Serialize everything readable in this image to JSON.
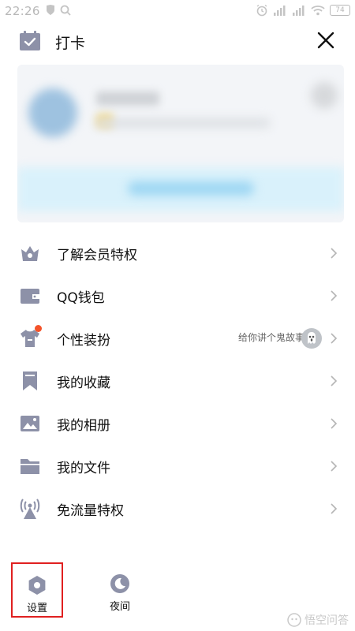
{
  "status_bar": {
    "time": "22:26",
    "battery": "74"
  },
  "header": {
    "checkin_label": "打卡"
  },
  "menu": {
    "items": [
      {
        "label": "了解会员特权",
        "icon": "crown-icon"
      },
      {
        "label": "QQ钱包",
        "icon": "wallet-icon"
      },
      {
        "label": "个性装扮",
        "icon": "tshirt-icon",
        "extra": "给你讲个鬼故事",
        "has_badge": true
      },
      {
        "label": "我的收藏",
        "icon": "bookmark-icon"
      },
      {
        "label": "我的相册",
        "icon": "photo-icon"
      },
      {
        "label": "我的文件",
        "icon": "folder-icon"
      },
      {
        "label": "免流量特权",
        "icon": "antenna-icon"
      }
    ]
  },
  "bottom": {
    "settings_label": "设置",
    "night_label": "夜间"
  },
  "watermark": {
    "text": "悟空问答"
  },
  "colors": {
    "icon": "#8d91a8",
    "highlight_border": "#e02020",
    "badge": "#f4532a"
  }
}
